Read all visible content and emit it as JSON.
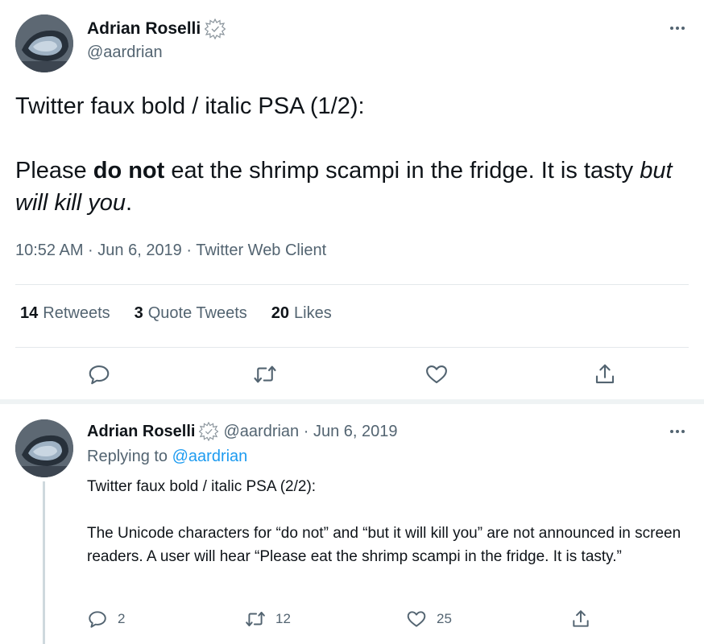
{
  "main_tweet": {
    "author_name": "Adrian Roselli",
    "handle": "@aardrian",
    "text_line1": "Twitter faux bold / italic PSA (1/2):",
    "text_line2_start": "Please ",
    "text_line2_bold": "do not",
    "text_line2_mid": " eat the shrimp scampi in the fridge. It is tasty ",
    "text_line2_italic": "but will kill you",
    "text_line2_end": ".",
    "timestamp": "10:52 AM · Jun 6, 2019 · Twitter Web Client",
    "stats": {
      "retweets_count": "14",
      "retweets_label": "Retweets",
      "quotes_count": "3",
      "quotes_label": "Quote Tweets",
      "likes_count": "20",
      "likes_label": "Likes"
    },
    "icons": [
      "reply-icon",
      "retweet-icon",
      "like-icon",
      "share-icon"
    ]
  },
  "reply_tweet": {
    "author_name": "Adrian Roselli",
    "handle_date": "@aardrian · Jun 6, 2019",
    "replying_prefix": "Replying to ",
    "replying_mention": "@aardrian",
    "text_line1": "Twitter faux bold / italic PSA (2/2):",
    "text_para2": "The Unicode characters for “do not” and “but it will kill you” are not announced in screen readers. A user will hear “Please eat the shrimp scampi in the fridge. It is tasty.”",
    "reply_count": "2",
    "retweet_count": "12",
    "like_count": "25"
  },
  "colors": {
    "text": "#0f1419",
    "secondary": "#536471",
    "link": "#1d9bf0",
    "border": "#e4e8eb"
  }
}
